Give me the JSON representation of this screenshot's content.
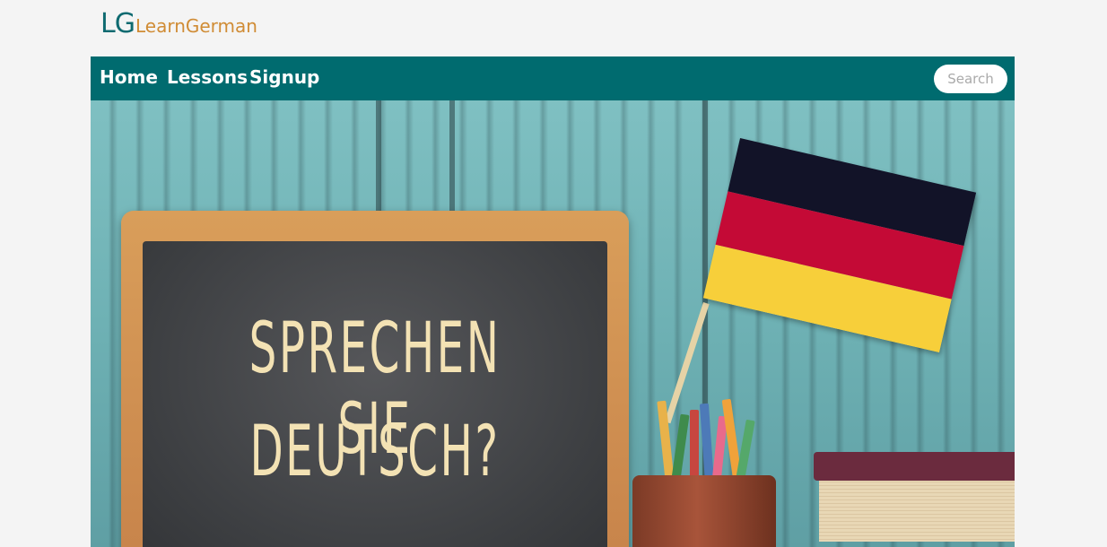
{
  "logo": {
    "mark": "LG",
    "text": "LearnGerman",
    "mark_color": "#0e6a70",
    "text_color": "#d08c35"
  },
  "nav": {
    "background": "#006b6f",
    "items": [
      {
        "label": "Home"
      },
      {
        "label": "Lessons"
      },
      {
        "label": "Signup"
      }
    ],
    "search_placeholder": "Search"
  },
  "hero": {
    "chalkboard_lines": [
      "SPRECHEN SIE",
      "DEUTSCH?"
    ],
    "flag": [
      "#121328",
      "#c40a36",
      "#f7cf3a"
    ]
  }
}
